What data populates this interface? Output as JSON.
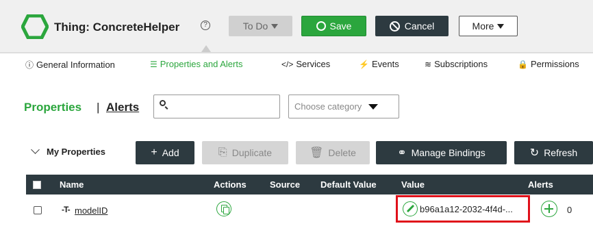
{
  "header": {
    "title": "Thing: ConcreteHelper",
    "help_icon": "help-circle-icon",
    "state_label": "To Do",
    "save_label": "Save",
    "cancel_label": "Cancel",
    "more_label": "More",
    "logo_color": "#2ba63d"
  },
  "tabs": [
    {
      "icon": "ⓘ",
      "label": "General Information",
      "active": false
    },
    {
      "icon": "☰",
      "label": "Properties and Alerts",
      "active": true
    },
    {
      "icon": "</>",
      "label": "Services",
      "active": false
    },
    {
      "icon": "⚡",
      "label": "Events",
      "active": false
    },
    {
      "icon": "≋",
      "label": "Subscriptions",
      "active": false
    },
    {
      "icon": "🔒",
      "label": "Permissions",
      "active": false
    }
  ],
  "filters": {
    "properties_label": "Properties",
    "separator": "|",
    "alerts_label": "Alerts",
    "search_value": "",
    "category_placeholder": "Choose category"
  },
  "toolbar": {
    "section_label": "My Properties",
    "add_label": "Add",
    "duplicate_label": "Duplicate",
    "delete_label": "Delete",
    "manage_bindings_label": "Manage Bindings",
    "refresh_label": "Refresh"
  },
  "table": {
    "columns": [
      "Name",
      "Actions",
      "Source",
      "Default Value",
      "Value",
      "Alerts"
    ],
    "rows": [
      {
        "type_icon": "-T-",
        "name": "modelID",
        "source": "",
        "default_value": "",
        "value": "b96a1a12-2032-4f4d-...",
        "alerts_count": "0"
      }
    ]
  },
  "colors": {
    "accent": "#2ba63d",
    "dark_button": "#2d3a40",
    "highlight_border": "#e0101a"
  }
}
